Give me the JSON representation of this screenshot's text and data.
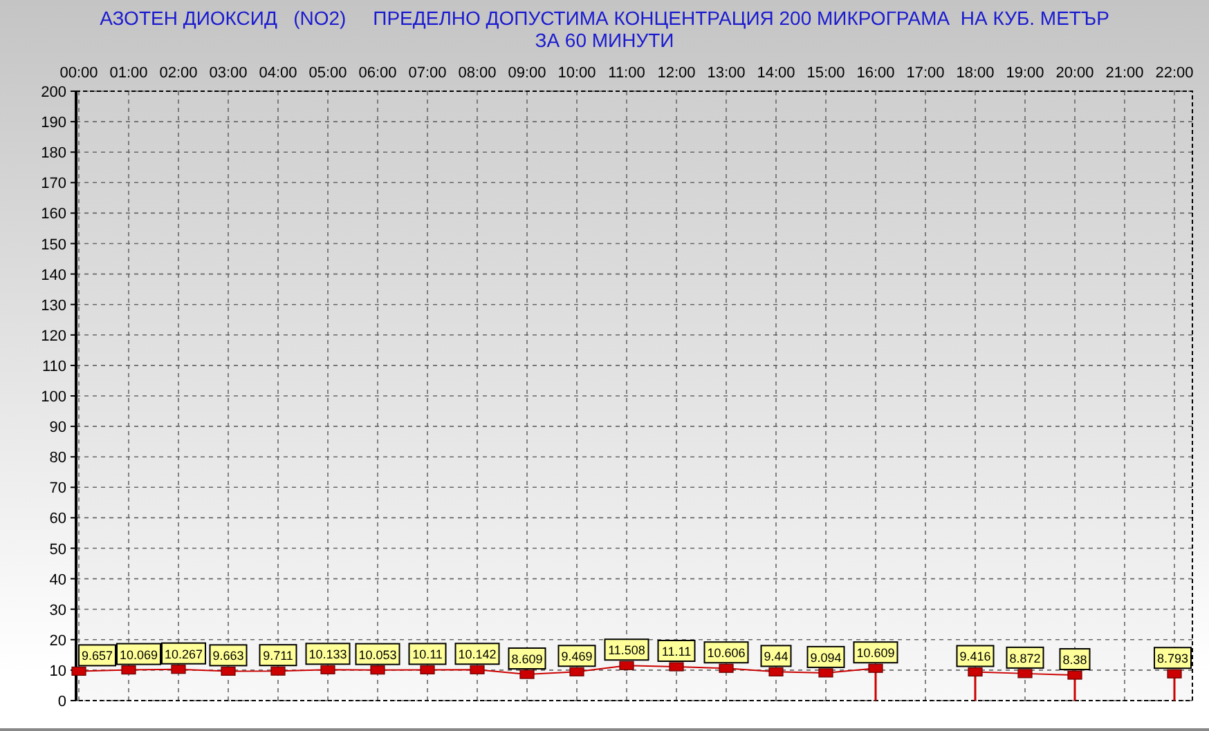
{
  "chart": {
    "title_lines": [
      "АЗОТЕН ДИОКСИД   (NO2)     ПРЕДЕЛНО ДОПУСТИМА КОНЦЕНТРАЦИЯ 200 МИКРОГРАМА  НА КУБ. МЕТЪР",
      "ЗА 60 МИНУТИ"
    ],
    "chart_data": {
      "type": "line",
      "data_labels": true,
      "grid": true,
      "categories": [
        "00:00",
        "01:00",
        "02:00",
        "03:00",
        "04:00",
        "05:00",
        "06:00",
        "07:00",
        "08:00",
        "09:00",
        "10:00",
        "11:00",
        "12:00",
        "13:00",
        "14:00",
        "15:00",
        "16:00",
        "17:00",
        "18:00",
        "19:00",
        "20:00",
        "21:00",
        "22:00"
      ],
      "series": [
        {
          "color": "#cc0000",
          "marker": "square",
          "values": [
            9.657,
            10.069,
            10.267,
            9.663,
            9.711,
            10.133,
            10.053,
            10.11,
            10.142,
            8.609,
            9.469,
            11.508,
            11.11,
            10.606,
            9.44,
            9.094,
            10.609,
            null,
            9.416,
            8.872,
            8.38,
            null,
            8.793
          ]
        }
      ],
      "ylim": [
        0,
        200
      ],
      "yticks": [
        0,
        10,
        20,
        30,
        40,
        50,
        60,
        70,
        80,
        90,
        100,
        110,
        120,
        130,
        140,
        150,
        160,
        170,
        180,
        190,
        200
      ]
    }
  }
}
